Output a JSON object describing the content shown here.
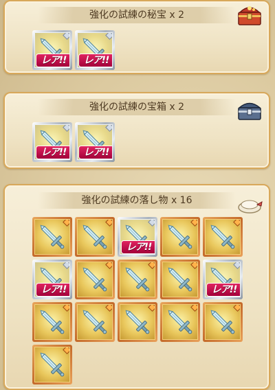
{
  "sections": [
    {
      "title": "強化の試練の秘宝 x 2",
      "icon": "red-treasure-chest-icon",
      "items": [
        {
          "frame": "silver",
          "rare": true
        },
        {
          "frame": "silver",
          "rare": true
        }
      ]
    },
    {
      "title": "強化の試練の宝箱 x 2",
      "icon": "blue-treasure-chest-icon",
      "items": [
        {
          "frame": "silver",
          "rare": true
        },
        {
          "frame": "silver",
          "rare": true
        }
      ]
    },
    {
      "title": "強化の試練の落し物 x 16",
      "icon": "pouch-icon",
      "items": [
        {
          "frame": "gold",
          "rare": false
        },
        {
          "frame": "gold",
          "rare": false
        },
        {
          "frame": "silver",
          "rare": true
        },
        {
          "frame": "gold",
          "rare": false
        },
        {
          "frame": "gold",
          "rare": false
        },
        {
          "frame": "silver",
          "rare": true
        },
        {
          "frame": "gold",
          "rare": false
        },
        {
          "frame": "gold",
          "rare": false
        },
        {
          "frame": "gold",
          "rare": false
        },
        {
          "frame": "silver",
          "rare": true
        },
        {
          "frame": "gold",
          "rare": false
        },
        {
          "frame": "gold",
          "rare": false
        },
        {
          "frame": "gold",
          "rare": false
        },
        {
          "frame": "gold",
          "rare": false
        },
        {
          "frame": "gold",
          "rare": false
        },
        {
          "frame": "gold",
          "rare": false
        }
      ]
    }
  ],
  "rare_label": "レア!!",
  "colors": {
    "panel_border": "#d8a85a",
    "rare_badge": "#c8144e",
    "title_text": "#4e3a22"
  }
}
